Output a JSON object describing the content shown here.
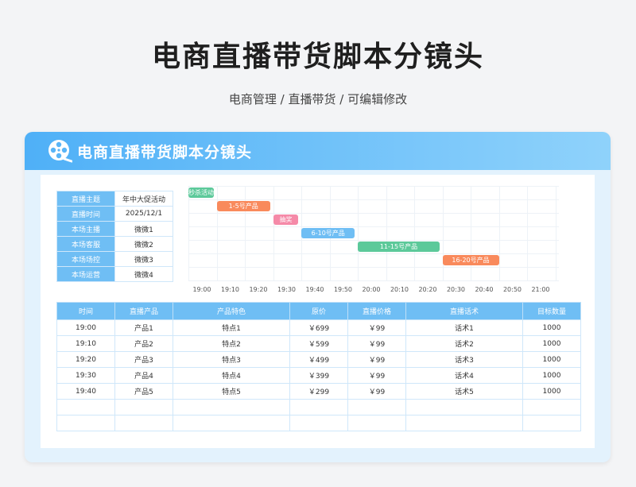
{
  "page": {
    "title": "电商直播带货脚本分镜头",
    "subtitle": "电商管理 / 直播带货 /  可编辑修改"
  },
  "card": {
    "title": "电商直播带货脚本分镜头",
    "logo_icon": "film-reel-icon"
  },
  "info": [
    {
      "label": "直播主题",
      "value": "年中大促活动"
    },
    {
      "label": "直播时间",
      "value": "2025/12/1"
    },
    {
      "label": "本场主播",
      "value": "微微1"
    },
    {
      "label": "本场客服",
      "value": "微微2"
    },
    {
      "label": "本场场控",
      "value": "微微3"
    },
    {
      "label": "本场运营",
      "value": "微微4"
    }
  ],
  "gantt": {
    "ticks": [
      "19:00",
      "19:10",
      "19:20",
      "19:30",
      "19:40",
      "19:50",
      "20:00",
      "20:10",
      "20:20",
      "20:30",
      "20:40",
      "20:50",
      "21:00"
    ],
    "tasks": [
      {
        "label": "秒杀活动",
        "start": 0,
        "end": 0.9,
        "color": "#5cc99a"
      },
      {
        "label": "1-5号产品",
        "start": 1,
        "end": 2.9,
        "color": "#f98a5c"
      },
      {
        "label": "抽奖",
        "start": 3,
        "end": 3.9,
        "color": "#f58aa8"
      },
      {
        "label": "6-10号产品",
        "start": 4,
        "end": 5.9,
        "color": "#6fbef4"
      },
      {
        "label": "11-15号产品",
        "start": 6,
        "end": 8.9,
        "color": "#5cc99a"
      },
      {
        "label": "16-20号产品",
        "start": 9,
        "end": 11,
        "color": "#f98a5c"
      }
    ]
  },
  "table": {
    "headers": [
      "时间",
      "直播产品",
      "产品特色",
      "原价",
      "直播价格",
      "直播话术",
      "目标数量"
    ],
    "rows": [
      [
        "19:00",
        "产品1",
        "特点1",
        "￥699",
        "￥99",
        "话术1",
        "1000"
      ],
      [
        "19:10",
        "产品2",
        "特点2",
        "￥599",
        "￥99",
        "话术2",
        "1000"
      ],
      [
        "19:20",
        "产品3",
        "特点3",
        "￥499",
        "￥99",
        "话术3",
        "1000"
      ],
      [
        "19:30",
        "产品4",
        "特点4",
        "￥399",
        "￥99",
        "话术4",
        "1000"
      ],
      [
        "19:40",
        "产品5",
        "特点5",
        "￥299",
        "￥99",
        "话术5",
        "1000"
      ],
      [
        "",
        "",
        "",
        "",
        "",
        "",
        ""
      ],
      [
        "",
        "",
        "",
        "",
        "",
        "",
        ""
      ]
    ]
  }
}
